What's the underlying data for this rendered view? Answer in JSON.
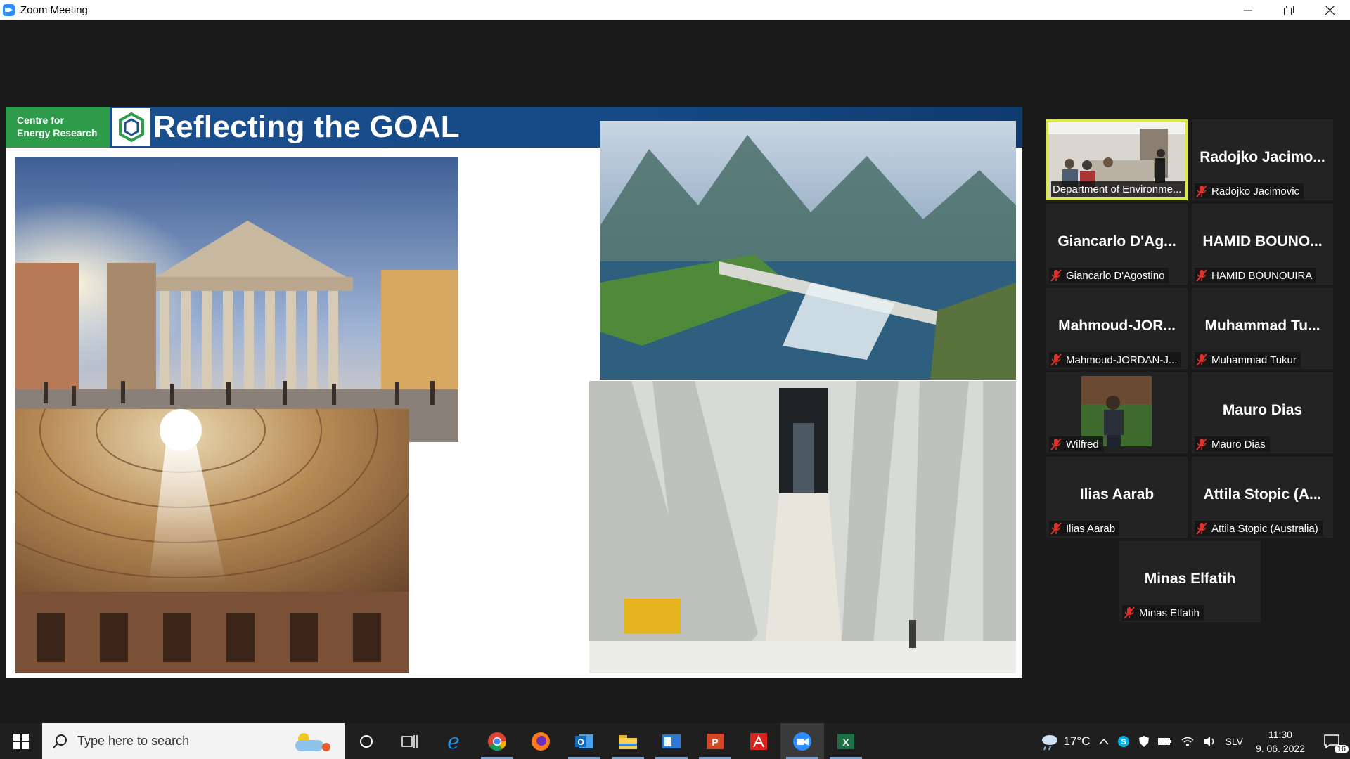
{
  "window": {
    "title": "Zoom Meeting",
    "minimize_icon": "minimize-icon",
    "maximize_icon": "restore-icon",
    "close_icon": "close-icon"
  },
  "slide": {
    "badge_line1": "Centre for",
    "badge_line2": "Energy Research",
    "title": "Reflecting the GOAL",
    "header_color": "#1b4f8f",
    "badge_color": "#2e9c4a",
    "photos": [
      "pantheon-exterior-photo",
      "pantheon-dome-interior-photo",
      "hydroelectric-dam-photo",
      "dam-spillway-photo"
    ]
  },
  "participants": [
    {
      "big": "",
      "label": "Department of Environme...",
      "video": true,
      "active": true
    },
    {
      "big": "Radojko Jacimo...",
      "label": "Radojko Jacimovic",
      "muted": true
    },
    {
      "big": "Giancarlo D'Ag...",
      "label": "Giancarlo D'Agostino",
      "muted": true
    },
    {
      "big": "HAMID BOUNO...",
      "label": "HAMID BOUNOUIRA",
      "muted": true
    },
    {
      "big": "Mahmoud-JOR...",
      "label": "Mahmoud-JORDAN-J...",
      "muted": true
    },
    {
      "big": "Muhammad Tu...",
      "label": "Muhammad Tukur",
      "muted": true
    },
    {
      "big": "",
      "label": "Wilfred",
      "muted": true,
      "avatar": true
    },
    {
      "big": "Mauro Dias",
      "label": "Mauro Dias",
      "muted": true
    },
    {
      "big": "Ilias Aarab",
      "label": "Ilias Aarab",
      "muted": true
    },
    {
      "big": "Attila Stopic (A...",
      "label": "Attila Stopic (Australia)",
      "muted": true
    },
    {
      "big": "Minas Elfatih",
      "label": "Minas Elfatih",
      "muted": true
    }
  ],
  "taskbar": {
    "search_placeholder": "Type here to search",
    "apps": [
      "cortana-icon",
      "task-view-icon",
      "edge-icon",
      "chrome-icon",
      "firefox-icon",
      "outlook-icon",
      "file-explorer-icon",
      "window-app-icon",
      "powerpoint-icon",
      "acrobat-icon",
      "zoom-icon",
      "excel-icon"
    ],
    "temperature": "17°C",
    "language": "SLV",
    "time": "11:30",
    "date": "9. 06. 2022",
    "notifications": "16"
  }
}
